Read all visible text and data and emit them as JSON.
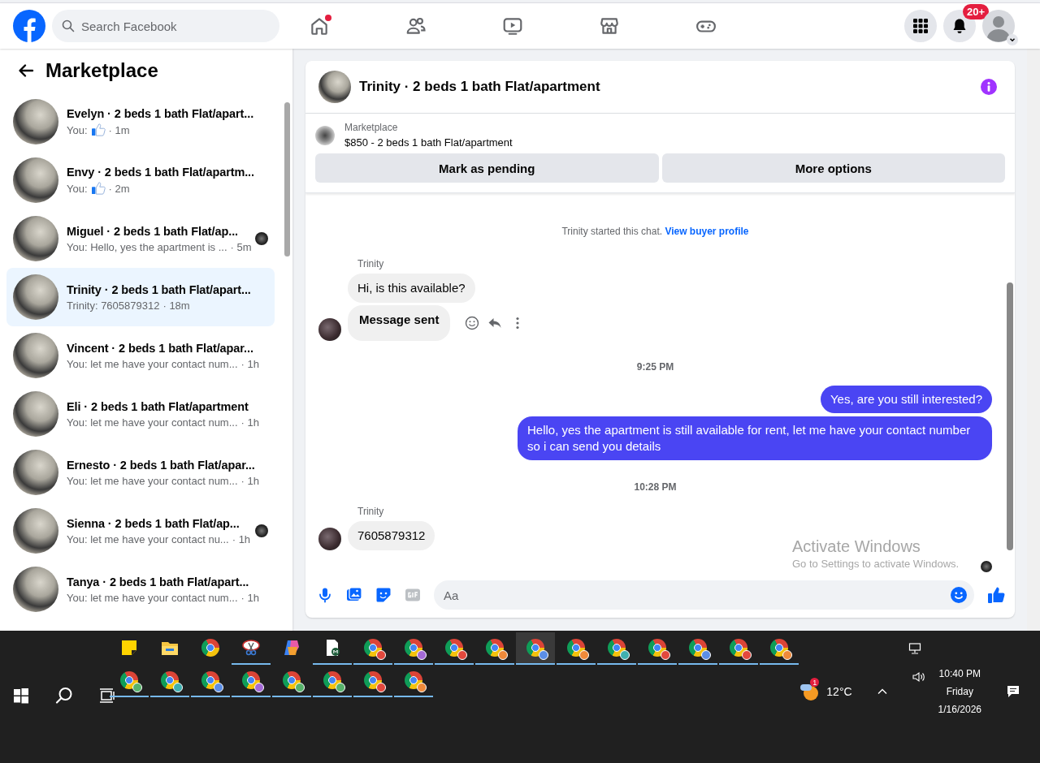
{
  "top_bar": {
    "search": {
      "placeholder": "Search Facebook"
    },
    "nav": [
      {
        "kind": "home",
        "dot": true
      },
      {
        "kind": "friends",
        "dot": false
      },
      {
        "kind": "video",
        "dot": false
      },
      {
        "kind": "marketplace",
        "dot": false
      },
      {
        "kind": "gaming",
        "dot": false
      }
    ],
    "notifications_badge": "20+"
  },
  "sidebar": {
    "title": "Marketplace",
    "conversations": [
      {
        "title": "Evelyn · 2 beds 1 bath Flat/apart...",
        "preview": "You:",
        "liked": true,
        "time": "· 1m",
        "seen": false,
        "selected": false
      },
      {
        "title": "Envy · 2 beds 1 bath Flat/apartm...",
        "preview": "You:",
        "liked": true,
        "time": "· 2m",
        "seen": false,
        "selected": false
      },
      {
        "title": "Miguel · 2 beds 1 bath Flat/ap...",
        "preview": "You: Hello, yes the apartment is ...",
        "liked": false,
        "time": "· 5m",
        "seen": true,
        "selected": false
      },
      {
        "title": "Trinity · 2 beds 1 bath Flat/apart...",
        "preview": "Trinity: 7605879312",
        "liked": false,
        "time": "· 18m",
        "seen": false,
        "selected": true
      },
      {
        "title": "Vincent · 2 beds 1 bath Flat/apar...",
        "preview": "You: let me have your contact num...",
        "liked": false,
        "time": "· 1h",
        "seen": false,
        "selected": false
      },
      {
        "title": "Eli · 2 beds 1 bath Flat/apartment",
        "preview": "You: let me have your contact num...",
        "liked": false,
        "time": "· 1h",
        "seen": false,
        "selected": false
      },
      {
        "title": "Ernesto · 2 beds 1 bath Flat/apar...",
        "preview": "You: let me have your contact num...",
        "liked": false,
        "time": "· 1h",
        "seen": false,
        "selected": false
      },
      {
        "title": "Sienna · 2 beds 1 bath Flat/ap...",
        "preview": "You: let me have your contact nu...",
        "liked": false,
        "time": "· 1h",
        "seen": true,
        "selected": false
      },
      {
        "title": "Tanya · 2 beds 1 bath Flat/apart...",
        "preview": "You: let me have your contact num...",
        "liked": false,
        "time": "· 1h",
        "seen": false,
        "selected": false
      }
    ]
  },
  "chat": {
    "title": "Trinity · 2 beds 1 bath Flat/apartment",
    "listing": {
      "label": "Marketplace",
      "text": "$850 - 2 beds 1 bath Flat/apartment"
    },
    "buttons": [
      "Mark as pending",
      "More options"
    ],
    "messages": [
      {
        "kind": "notice",
        "text": "Trinity started this chat.",
        "link": "View buyer profile"
      },
      {
        "kind": "incoming",
        "sender": "Trinity",
        "text": "Hi, is this available?",
        "avatar": false,
        "bold": false,
        "actions": false
      },
      {
        "kind": "incoming",
        "text": "Message sent",
        "avatar": true,
        "bold": true,
        "actions": true
      },
      {
        "kind": "time",
        "text": "9:25 PM"
      },
      {
        "kind": "outgoing",
        "text": "Yes, are you still interested?"
      },
      {
        "kind": "outgoing",
        "text": "Hello, yes the apartment is still available for rent, let me have your contact number so i can send you details"
      },
      {
        "kind": "time",
        "text": "10:28 PM"
      },
      {
        "kind": "incoming",
        "sender": "Trinity",
        "text": "7605879312",
        "avatar": true,
        "bold": false,
        "actions": false
      }
    ],
    "seen": true,
    "composer": {
      "placeholder": "Aa"
    }
  },
  "os_overlay": {
    "title": "Activate Windows",
    "subtitle": "Go to Settings to activate Windows."
  },
  "taskbar": {
    "app_rows": [
      [
        {
          "kind": "sticky-notes",
          "running": false,
          "selected": false
        },
        {
          "kind": "file-explorer",
          "running": false,
          "selected": false
        },
        {
          "kind": "chrome",
          "running": false,
          "selected": false
        },
        {
          "kind": "snipping",
          "running": true,
          "selected": false
        },
        {
          "kind": "copilot",
          "running": false,
          "selected": false
        },
        {
          "kind": "document",
          "running": true,
          "selected": false
        },
        {
          "kind": "chrome-profile",
          "color": "#e2483d",
          "running": true,
          "selected": false
        },
        {
          "kind": "chrome-profile",
          "color": "#a46ad6",
          "running": true,
          "selected": false
        },
        {
          "kind": "chrome-profile",
          "color": "#e2483d",
          "running": true,
          "selected": false
        },
        {
          "kind": "chrome-profile",
          "color": "#ef8a3a",
          "running": true,
          "selected": false
        },
        {
          "kind": "chrome-profile",
          "color": "#5b8ee6",
          "running": true,
          "selected": true
        },
        {
          "kind": "chrome-profile",
          "color": "#ef8a3a",
          "running": true,
          "selected": false
        },
        {
          "kind": "chrome-profile",
          "color": "#3fb0b0",
          "running": true,
          "selected": false
        },
        {
          "kind": "chrome-profile",
          "color": "#e2483d",
          "running": true,
          "selected": false
        },
        {
          "kind": "chrome-profile",
          "color": "#5b8ee6",
          "running": true,
          "selected": false
        },
        {
          "kind": "chrome-profile",
          "color": "#e2483d",
          "running": true,
          "selected": false
        },
        {
          "kind": "chrome-profile",
          "color": "#ef8a3a",
          "running": true,
          "selected": false
        }
      ],
      [
        {
          "kind": "chrome-profile",
          "color": "#57b36b",
          "running": true,
          "selected": false
        },
        {
          "kind": "chrome-profile",
          "color": "#3fb0b0",
          "running": true,
          "selected": false
        },
        {
          "kind": "chrome-profile",
          "color": "#5b8ee6",
          "running": true,
          "selected": false
        },
        {
          "kind": "chrome-profile",
          "color": "#a46ad6",
          "running": true,
          "selected": false
        },
        {
          "kind": "chrome-profile",
          "color": "#57b36b",
          "running": true,
          "selected": false
        },
        {
          "kind": "chrome-profile",
          "color": "#57b36b",
          "running": true,
          "selected": false
        },
        {
          "kind": "chrome-profile",
          "color": "#e2483d",
          "running": true,
          "selected": false
        },
        {
          "kind": "chrome-profile",
          "color": "#ef8a3a",
          "running": true,
          "selected": false
        }
      ]
    ],
    "weather": {
      "temp": "12°C",
      "badge": "1"
    },
    "time": "10:40 PM",
    "day": "Friday",
    "date": "1/16/2026"
  }
}
